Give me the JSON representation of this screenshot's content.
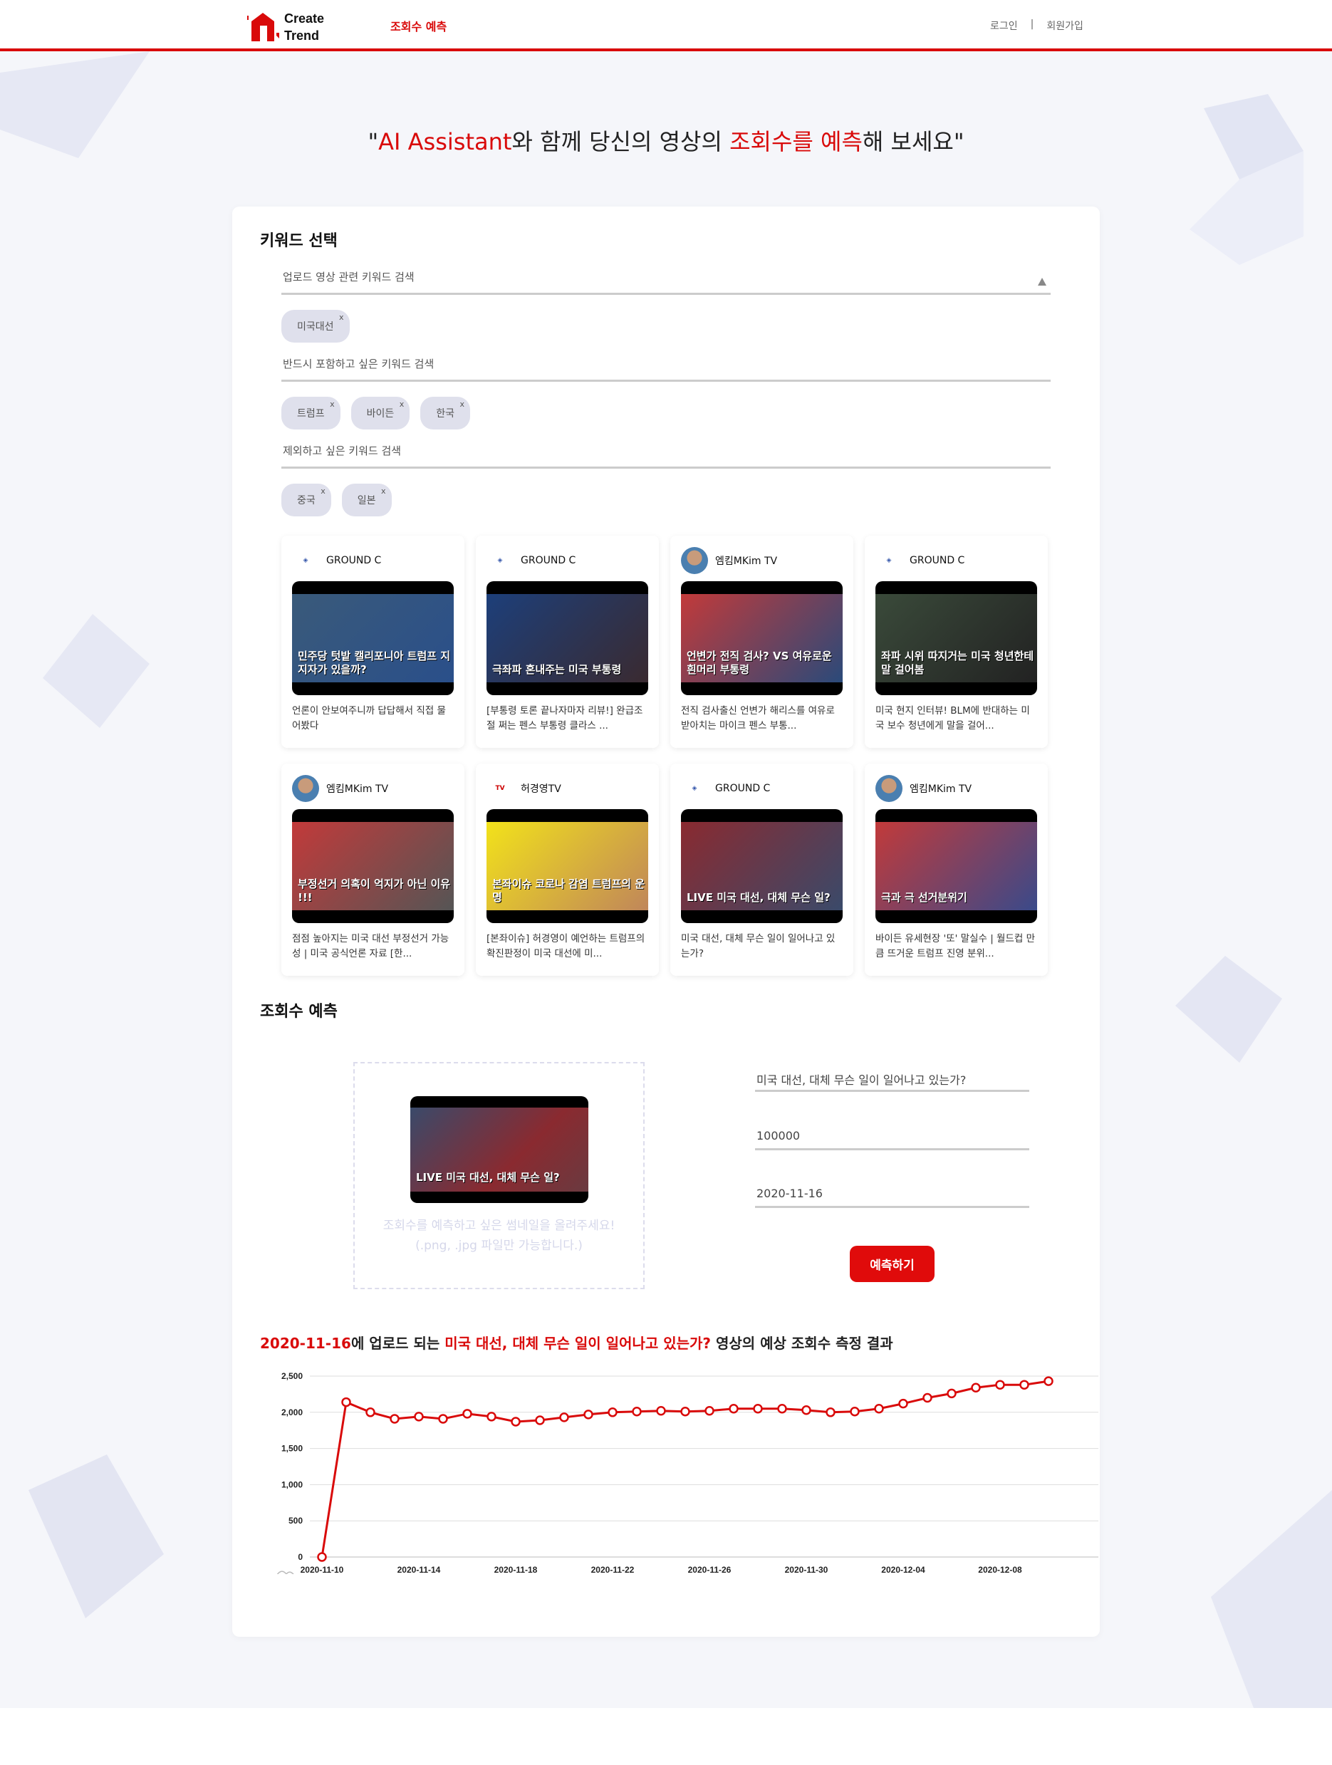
{
  "header": {
    "logo_line1": "Create",
    "logo_line2": "Trend",
    "nav": "조회수 예측",
    "login": "로그인",
    "separator": "|",
    "signup": "회원가입"
  },
  "headline": {
    "q1": "\"",
    "accent1": "AI Assistant",
    "mid": "와 함께 당신의 영상의 ",
    "accent2": "조회수를 예측",
    "end": "해 보세요\""
  },
  "keywords": {
    "title": "키워드 선택",
    "related_placeholder": "업로드 영상 관련 키워드 검색",
    "related_chips": [
      "미국대선"
    ],
    "include_placeholder": "반드시 포함하고 싶은 키워드 검색",
    "include_chips": [
      "트럼프",
      "바이든",
      "한국"
    ],
    "exclude_placeholder": "제외하고 싶은 키워드 검색",
    "exclude_chips": [
      "중국",
      "일본"
    ],
    "chip_close": "x"
  },
  "videos": [
    {
      "channel": "GROUND C",
      "avatar": "ground-c",
      "caption": "민주당 텃밭 캘리포니아 트럼프 지지자가 있을까?",
      "title": "언론이 안보여주니까 답답해서 직접 물어봤다",
      "colors": [
        "#3a5a7a",
        "#2a4f8a"
      ]
    },
    {
      "channel": "GROUND C",
      "avatar": "ground-c",
      "caption": "극좌파 혼내주는 미국 부통령",
      "title": "[부통령 토론 끝나자마자 리뷰!] 완급조절 쩌는 펜스 부통령 클라스 ...",
      "colors": [
        "#1d3f7a",
        "#3a2a30"
      ]
    },
    {
      "channel": "엠킴MKim TV",
      "avatar": "mkim",
      "caption": "언변가 전직 검사? VS 여유로운 흰머리 부통령",
      "title": "전직 검사출신 언변가 해리스를 여유로 받아치는 마이크 펜스 부통...",
      "colors": [
        "#c23a3a",
        "#2a4a7a"
      ]
    },
    {
      "channel": "GROUND C",
      "avatar": "ground-c",
      "caption": "좌파 시위 따지거는 미국 청년한테 말 걸어봄",
      "title": "미국 현지 인터뷰! BLM에 반대하는 미국 보수 청년에게 말을 걸어...",
      "colors": [
        "#3a4a3a",
        "#222"
      ]
    },
    {
      "channel": "엠킴MKim TV",
      "avatar": "mkim",
      "caption": "부정선거 의혹이 억지가 아닌 이유 !!!",
      "title": "점점 높아지는 미국 대선 부정선거 가능성 | 미국 공식언론 자료 [한...",
      "colors": [
        "#c23a3a",
        "#555"
      ]
    },
    {
      "channel": "허경영TV",
      "avatar": "heo",
      "caption": "본좌이슈 코로나 감염 트럼프의 운명",
      "title": "[본좌이슈] 허경영이 예언하는 트럼프의 확진판정이 미국 대선에 미...",
      "colors": [
        "#f2e21a",
        "#c0865a"
      ]
    },
    {
      "channel": "GROUND C",
      "avatar": "ground-c",
      "caption": "LIVE 미국 대선, 대체 무슨 일?",
      "title": "미국 대선, 대체 무슨 일이 일어나고 있는가?",
      "colors": [
        "#8a2a30",
        "#3a4a6a"
      ]
    },
    {
      "channel": "엠킴MKim TV",
      "avatar": "mkim",
      "caption": "극과 극 선거분위기",
      "title": "바이든 유세현장 '또' 말실수 | 월드컵 만큼 뜨거운 트럼프 진영 분위...",
      "colors": [
        "#c23a3a",
        "#3a4a8a"
      ]
    }
  ],
  "predict": {
    "title": "조회수 예측",
    "upload_caption": "LIVE 미국 대선, 대체 무슨 일?",
    "upload_hint1": "조회수를 예측하고 싶은 썸네일을 올려주세요!",
    "upload_hint2": "(.png, .jpg 파일만 가능합니다.)",
    "video_title": "미국 대선, 대체 무슨 일이 일어나고 있는가?",
    "subscribers": "100000",
    "upload_date": "2020-11-16",
    "submit": "예측하기"
  },
  "result": {
    "date": "2020-11-16",
    "t1": "에 업로드 되는 ",
    "video": "미국 대선, 대체 무슨 일이 일어나고 있는가?",
    "t2": " 영상의 예상 조회수 측정 결과"
  },
  "chart_data": {
    "type": "line",
    "title": "",
    "xlabel": "",
    "ylabel": "",
    "ylim": [
      0,
      2500
    ],
    "yticks": [
      0,
      500,
      1000,
      1500,
      2000,
      2500
    ],
    "ytick_labels": [
      "0",
      "500",
      "1,000",
      "1,500",
      "2,000",
      "2,500"
    ],
    "xtick_labels": [
      "2020-11-10",
      "2020-11-14",
      "2020-11-18",
      "2020-11-22",
      "2020-11-26",
      "2020-11-30",
      "2020-12-04",
      "2020-12-08"
    ],
    "x": [
      "2020-11-10",
      "2020-11-11",
      "2020-11-12",
      "2020-11-13",
      "2020-11-14",
      "2020-11-15",
      "2020-11-16",
      "2020-11-17",
      "2020-11-18",
      "2020-11-19",
      "2020-11-20",
      "2020-11-21",
      "2020-11-22",
      "2020-11-23",
      "2020-11-24",
      "2020-11-25",
      "2020-11-26",
      "2020-11-27",
      "2020-11-28",
      "2020-11-29",
      "2020-11-30",
      "2020-12-01",
      "2020-12-02",
      "2020-12-03",
      "2020-12-04",
      "2020-12-05",
      "2020-12-06",
      "2020-12-07",
      "2020-12-08",
      "2020-12-09",
      "2020-12-10"
    ],
    "series": [
      {
        "name": "예상 조회수",
        "color": "#d90a0a",
        "values": [
          0,
          2140,
          2000,
          1910,
          1940,
          1910,
          1980,
          1940,
          1870,
          1890,
          1930,
          1970,
          2000,
          2010,
          2020,
          2010,
          2020,
          2050,
          2050,
          2050,
          2030,
          2000,
          2010,
          2050,
          2120,
          2200,
          2260,
          2340,
          2380,
          2380,
          2430
        ]
      }
    ],
    "grid": true,
    "legend": "none"
  }
}
